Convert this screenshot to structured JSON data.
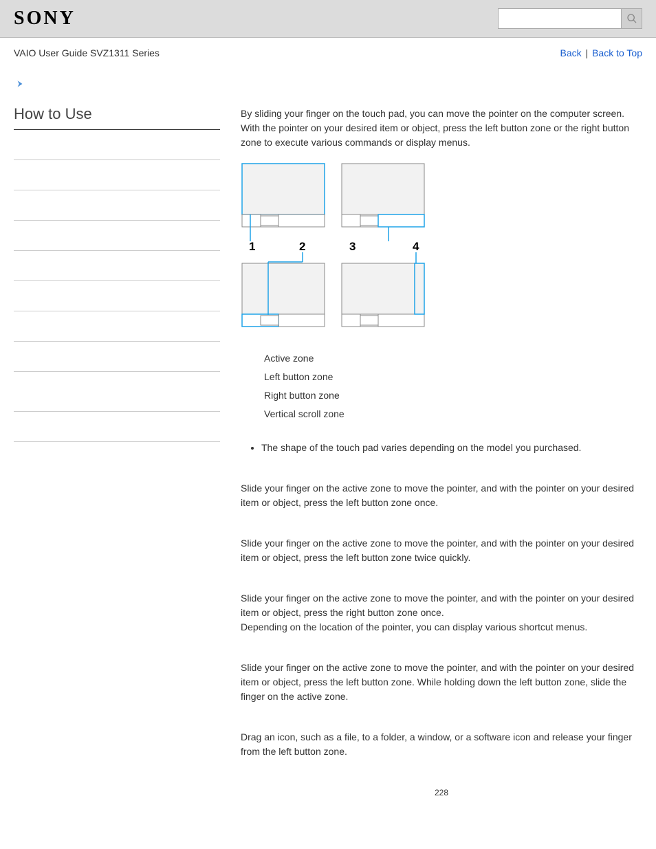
{
  "header": {
    "logo": "SONY",
    "search_placeholder": ""
  },
  "meta": {
    "guide_title": "VAIO User Guide SVZ1311 Series",
    "back_link": "Back",
    "separator": "|",
    "top_link": "Back to Top"
  },
  "sidebar": {
    "title": "How to Use"
  },
  "intro": "By sliding your finger on the touch pad, you can move the pointer on the computer screen. With the pointer on your desired item or object, press the left button zone or the right button zone to execute various commands or display menus.",
  "diagram": {
    "labels": {
      "n1": "1",
      "n2": "2",
      "n3": "3",
      "n4": "4"
    }
  },
  "zones": [
    "Active zone",
    "Left button zone",
    "Right button zone",
    "Vertical scroll zone"
  ],
  "note": "The shape of the touch pad varies depending on the model you purchased.",
  "sections": [
    "Slide your finger on the active zone to move the pointer, and with the pointer on your desired item or object, press the left button zone once.",
    "Slide your finger on the active zone to move the pointer, and with the pointer on your desired item or object, press the left button zone twice quickly.",
    "Slide your finger on the active zone to move the pointer, and with the pointer on your desired item or object, press the right button zone once.\nDepending on the location of the pointer, you can display various shortcut menus.",
    "Slide your finger on the active zone to move the pointer, and with the pointer on your desired item or object, press the left button zone. While holding down the left button zone, slide the finger on the active zone.",
    "Drag an icon, such as a file, to a folder, a window, or a software icon and release your finger from the left button zone."
  ],
  "page_number": "228"
}
